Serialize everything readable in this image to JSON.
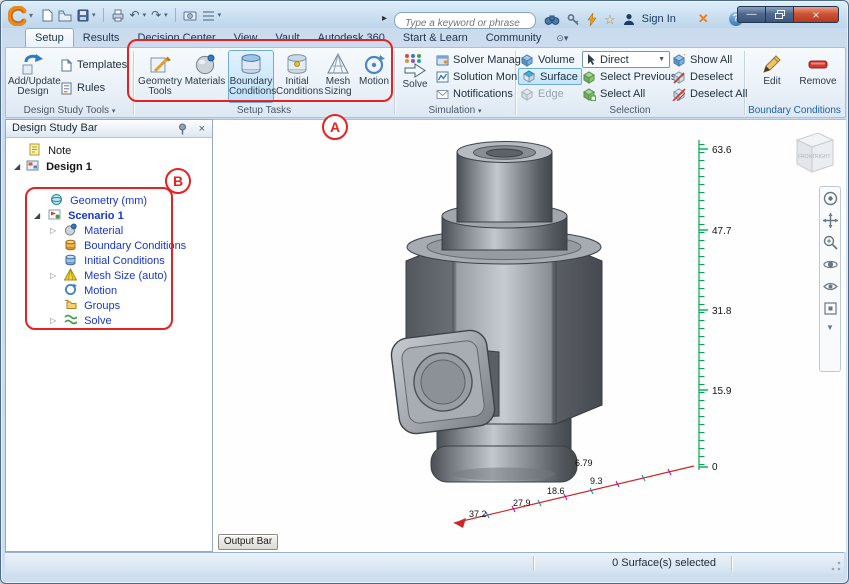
{
  "colors": {
    "annotation_red": "#e42222",
    "highlight_blue_bg": "#c3e3f8",
    "highlight_blue_border": "#6fadd7",
    "ruler_green": "#00a94f",
    "axis_red": "#cc2626"
  },
  "titlebar": {
    "search_placeholder": "Type a keyword or phrase",
    "sign_in_label": "Sign In",
    "qat_icons": [
      "new-icon",
      "open-icon",
      "save-icon",
      "print-icon",
      "undo-icon",
      "redo-icon",
      "capture-icon",
      "options-icon"
    ],
    "right_icons": [
      "binoculars-icon",
      "key-icon",
      "lightning-icon",
      "star-icon",
      "person-icon",
      "exchange-apps-icon",
      "help-icon"
    ]
  },
  "tabs": {
    "items": [
      {
        "label": "Setup",
        "active": true
      },
      {
        "label": "Results"
      },
      {
        "label": "Decision Center"
      },
      {
        "label": "View"
      },
      {
        "label": "Vault"
      },
      {
        "label": "Autodesk 360"
      },
      {
        "label": "Start & Learn"
      },
      {
        "label": "Community"
      }
    ]
  },
  "ribbon": {
    "design_study_tools": {
      "panel_label": "Design Study Tools",
      "add_update_design": "Add/Update Design",
      "templates": "Templates",
      "rules": "Rules"
    },
    "setup_tasks": {
      "panel_label": "Setup Tasks",
      "geometry_tools": "Geometry Tools",
      "materials": "Materials",
      "boundary_conditions": "Boundary Conditions",
      "initial_conditions": "Initial Conditions",
      "mesh_sizing": "Mesh Sizing",
      "motion": "Motion"
    },
    "simulation": {
      "panel_label": "Simulation",
      "solve": "Solve",
      "solver_manager": "Solver Manager",
      "solution_monitor": "Solution Monitor",
      "notifications": "Notifications"
    },
    "selection": {
      "panel_label": "Selection",
      "volume": "Volume",
      "surface": "Surface",
      "edge": "Edge",
      "direct": "Direct",
      "select_previous": "Select Previous",
      "select_all": "Select All",
      "show_all": "Show All",
      "deselect": "Deselect",
      "deselect_all": "Deselect All"
    },
    "boundary_conditions_panel": {
      "panel_label": "Boundary Conditions",
      "edit": "Edit",
      "remove": "Remove"
    }
  },
  "design_study_bar": {
    "title": "Design Study Bar",
    "tree": {
      "note": "Note",
      "design": "Design 1",
      "geometry": "Geometry (mm)",
      "scenario": "Scenario 1",
      "material": "Material",
      "boundary_conditions": "Boundary Conditions",
      "initial_conditions": "Initial Conditions",
      "mesh_size": "Mesh Size (auto)",
      "motion": "Motion",
      "groups": "Groups",
      "solve": "Solve"
    }
  },
  "viewport": {
    "ruler_values": [
      "63.6",
      "47.7",
      "31.8",
      "15.9",
      "0"
    ],
    "axis_values": [
      "6.79",
      "9.3",
      "18.6",
      "27.9",
      "37.2"
    ],
    "viewcube": {
      "front": "FRONT",
      "right": "RIGHT"
    },
    "output_bar_label": "Output Bar"
  },
  "statusbar": {
    "selection_status": "0 Surface(s) selected"
  },
  "annotations": {
    "a": "A",
    "b": "B"
  }
}
